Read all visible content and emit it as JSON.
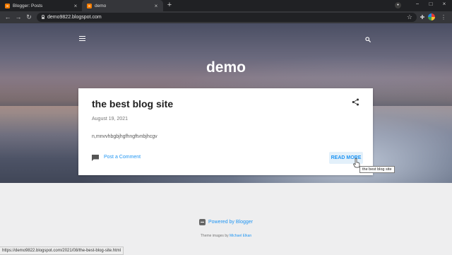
{
  "browser": {
    "tabs": [
      {
        "title": "Blogger: Posts",
        "active": false
      },
      {
        "title": "demo",
        "active": true
      }
    ],
    "url": "demo9822.blogspot.com",
    "status_url": "https://demo9822.blogspot.com/2021/08/the-best-blog-site.html",
    "new_tab": "+",
    "close_glyph": "×",
    "window_controls": [
      "−",
      "□",
      "×"
    ]
  },
  "blog": {
    "site_title": "demo",
    "post": {
      "title": "the best blog site",
      "date": "August 19, 2021",
      "snippet": "n,mnvvhbgbjhgfhngftvnbjhcgv",
      "comment_link": "Post a Comment",
      "read_more": "READ MORE",
      "tooltip": "the best blog site"
    }
  },
  "footer": {
    "powered_by": "Powered by Blogger",
    "theme_prefix": "Theme images by",
    "theme_author": "Michael Elkan"
  },
  "icons": [
    "hamburger-menu-icon",
    "search-icon",
    "share-icon",
    "comment-icon",
    "blogger-icon",
    "lock-icon",
    "star-icon",
    "puzzle-icon",
    "back-icon",
    "forward-icon",
    "reload-icon"
  ],
  "colors": {
    "accent": "#2196f3",
    "browser_dark": "#202124",
    "browser_toolbar": "#35363a",
    "blogger_orange": "#f57d00"
  }
}
